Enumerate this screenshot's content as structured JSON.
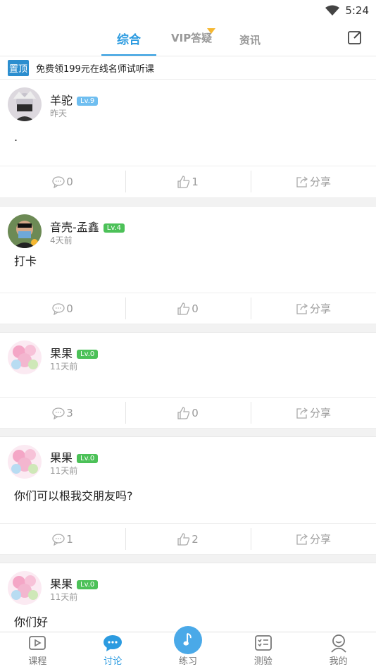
{
  "status": {
    "time": "5:24"
  },
  "tabs": [
    {
      "label": "综合"
    },
    {
      "label": "VIP答疑"
    },
    {
      "label": "资讯"
    }
  ],
  "pinned": {
    "badge": "置顶",
    "text": "免费领199元在线名师试听课"
  },
  "posts": [
    {
      "user": "羊驼",
      "level": "Lv.9",
      "time": "昨天",
      "content": ".",
      "comments": "0",
      "likes": "1",
      "share": "分享"
    },
    {
      "user": "音壳-孟鑫",
      "level": "Lv.4",
      "time": "4天前",
      "content": "打卡",
      "comments": "0",
      "likes": "0",
      "share": "分享"
    },
    {
      "user": "果果",
      "level": "Lv.0",
      "time": "11天前",
      "content": "",
      "comments": "3",
      "likes": "0",
      "share": "分享"
    },
    {
      "user": "果果",
      "level": "Lv.0",
      "time": "11天前",
      "content": "你们可以根我交朋友吗?",
      "comments": "1",
      "likes": "2",
      "share": "分享"
    },
    {
      "user": "果果",
      "level": "Lv.0",
      "time": "11天前",
      "content": "你们好"
    }
  ],
  "nav": [
    {
      "label": "课程",
      "icon": "course-icon"
    },
    {
      "label": "讨论",
      "icon": "discussion-icon"
    },
    {
      "label": "练习",
      "icon": "music-note-icon"
    },
    {
      "label": "测验",
      "icon": "quiz-icon"
    },
    {
      "label": "我的",
      "icon": "profile-icon"
    }
  ],
  "colors": {
    "accent": "#2c9be0",
    "level_blue": "#6fbef0",
    "level_green": "#4cc158"
  }
}
